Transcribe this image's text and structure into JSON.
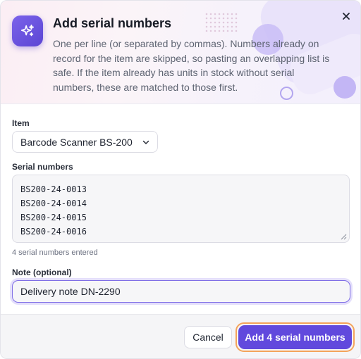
{
  "dialog": {
    "title": "Add serial numbers",
    "description": "One per line (or separated by commas). Numbers already on record for the item are skipped, so pasting an overlapping list is safe. If the item already has units in stock without serial numbers, these are matched to those first."
  },
  "form": {
    "item_label": "Item",
    "item_value": "Barcode Scanner BS-200",
    "serials_label": "Serial numbers",
    "serials": [
      "BS200-24-0013",
      "BS200-24-0014",
      "BS200-24-0015",
      "BS200-24-0016"
    ],
    "serials_count_text": "4 serial numbers entered",
    "note_label": "Note (optional)",
    "note_value": "Delivery note DN-2290"
  },
  "footer": {
    "cancel_label": "Cancel",
    "submit_label": "Add 4 serial numbers"
  },
  "icons": {
    "header_icon": "sparkles-icon",
    "close": "close-icon",
    "select_chevron": "chevron-down-icon"
  },
  "colors": {
    "accent": "#6149dd",
    "focus_ring": "#f4a35a"
  }
}
